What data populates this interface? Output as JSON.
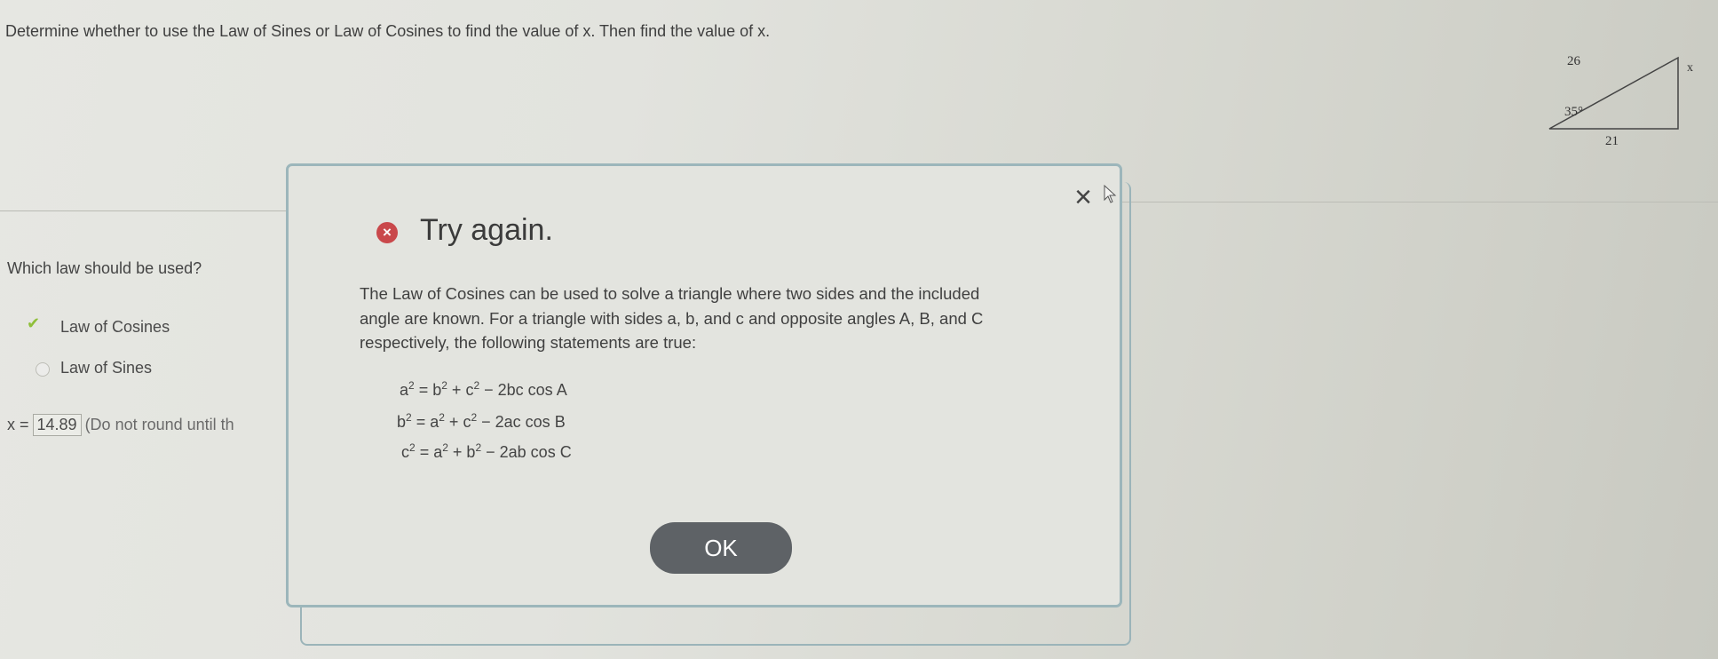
{
  "question": "Determine whether to use the Law of Sines or Law of Cosines to find the value of x. Then find the value of x.",
  "figure": {
    "side_top": "26",
    "side_right": "x",
    "angle": "35°",
    "side_bottom": "21"
  },
  "law_question": "Which law should be used?",
  "options": [
    {
      "label": "Law of Cosines",
      "selected": true
    },
    {
      "label": "Law of Sines",
      "selected": false
    }
  ],
  "answer": {
    "prefix": "x =",
    "value": "14.89",
    "hint": "(Do not round until th"
  },
  "modal": {
    "title": "Try again.",
    "explanation": "The Law of Cosines can be used to solve a triangle where two sides and the included angle are known. For a triangle with sides a, b, and c and opposite angles A, B, and C respectively, the following statements are true:",
    "formulas": [
      {
        "lhs": "a",
        "t1": "b",
        "t2": "c",
        "tail": "− 2bc cos A"
      },
      {
        "lhs": "b",
        "t1": "a",
        "t2": "c",
        "tail": "− 2ac cos B"
      },
      {
        "lhs": "c",
        "t1": "a",
        "t2": "b",
        "tail": "− 2ab cos C"
      }
    ],
    "exponent": "2",
    "ok_label": "OK"
  },
  "colors": {
    "modal_border": "#9cb6bb",
    "error_red": "#c9484b",
    "check_green": "#8fbf3a",
    "ok_button": "#5e6266"
  }
}
